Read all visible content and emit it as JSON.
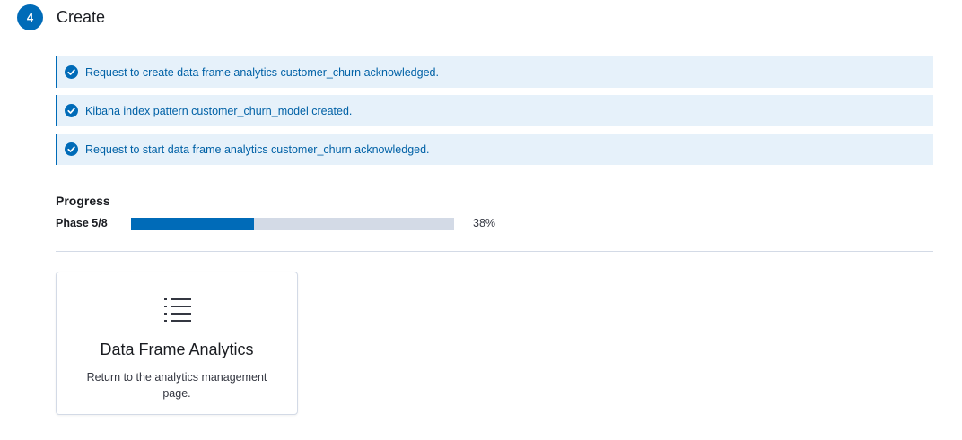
{
  "step": {
    "number": "4",
    "title": "Create"
  },
  "callouts": [
    {
      "text": "Request to create data frame analytics customer_churn acknowledged.",
      "icon": "check-circle-icon"
    },
    {
      "text": "Kibana index pattern customer_churn_model created.",
      "icon": "check-circle-icon"
    },
    {
      "text": "Request to start data frame analytics customer_churn acknowledged.",
      "icon": "check-circle-icon"
    }
  ],
  "progress": {
    "title": "Progress",
    "phase_label": "Phase 5/8",
    "percent_label": "38%",
    "percent": 38
  },
  "card": {
    "icon": "list-icon",
    "title": "Data Frame Analytics",
    "description": "Return to the analytics management page."
  },
  "colors": {
    "accent": "#006bb8",
    "callout_bg": "#e6f1fa",
    "track": "#d3dae6"
  }
}
